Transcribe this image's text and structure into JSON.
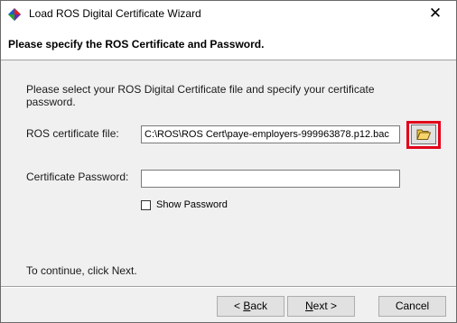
{
  "window": {
    "title": "Load ROS Digital Certificate Wizard",
    "close_glyph": "✕"
  },
  "header": {
    "text": "Please specify the ROS Certificate and Password."
  },
  "intro": "Please select your ROS Digital Certificate file and specify your certificate password.",
  "certificate_file": {
    "label": "ROS certificate file:",
    "value": "C:\\ROS\\ROS Cert\\paye-employers-999963878.p12.bac",
    "browse_icon": "folder-open-icon"
  },
  "password": {
    "label": "Certificate Password:",
    "value": ""
  },
  "show_password": {
    "label": "Show Password",
    "checked": false
  },
  "continue_text": "To continue, click Next.",
  "buttons": {
    "back": {
      "pre": "< ",
      "acc": "B",
      "post": "ack"
    },
    "next": {
      "pre": "",
      "acc": "N",
      "post": "ext >"
    },
    "cancel": "Cancel"
  },
  "colors": {
    "highlight": "#e2001a",
    "header_bg": "#ffffff",
    "body_bg": "#f0f0f0"
  }
}
